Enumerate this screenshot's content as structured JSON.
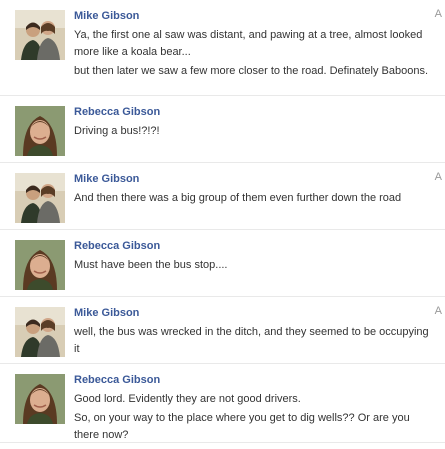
{
  "messages": [
    {
      "author": "Mike Gibson",
      "avatar": "couple-photo",
      "timestamp": "A",
      "lines": [
        "Ya, the first one al saw was distant, and pawing at a tree, almost looked more like a koala bear...",
        "but then later we saw a few more closer to the road. Definately Baboons."
      ]
    },
    {
      "author": "Rebecca Gibson",
      "avatar": "woman-portrait",
      "timestamp": "",
      "lines": [
        "Driving a bus!?!?!"
      ]
    },
    {
      "author": "Mike Gibson",
      "avatar": "couple-photo",
      "timestamp": "A",
      "lines": [
        "And then there was a big group of them even further down the road"
      ]
    },
    {
      "author": "Rebecca Gibson",
      "avatar": "woman-portrait",
      "timestamp": "",
      "lines": [
        "Must have been the bus stop...."
      ]
    },
    {
      "author": "Mike Gibson",
      "avatar": "couple-photo",
      "timestamp": "A",
      "lines": [
        "well, the bus was wrecked in the ditch, and they seemed to be occupying it"
      ]
    },
    {
      "author": "Rebecca Gibson",
      "avatar": "woman-portrait",
      "timestamp": "",
      "lines": [
        "Good lord. Evidently they are not good drivers.",
        "So, on your way to the place where you get to dig wells?? Or are you there now?"
      ]
    }
  ]
}
